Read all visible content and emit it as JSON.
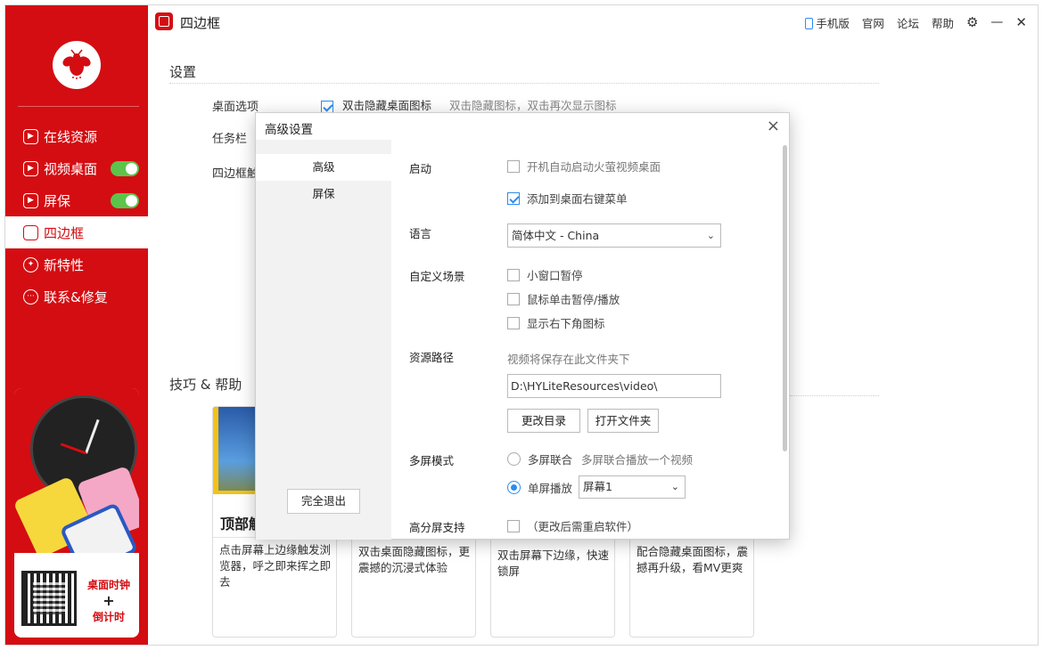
{
  "app": {
    "title": "四边框"
  },
  "top_links": {
    "mobile": "手机版",
    "official": "官网",
    "forum": "论坛",
    "help": "帮助"
  },
  "sidebar": {
    "items": [
      {
        "label": "在线资源",
        "icon": "play-icon",
        "toggle": false
      },
      {
        "label": "视频桌面",
        "icon": "play-icon",
        "toggle": true
      },
      {
        "label": "屏保",
        "icon": "play-icon",
        "toggle": true
      },
      {
        "label": "四边框",
        "icon": "frame-icon",
        "active": true
      },
      {
        "label": "新特性",
        "icon": "bulb-icon"
      },
      {
        "label": "联系&修复",
        "icon": "chat-icon"
      }
    ],
    "promo": {
      "line1": "桌面时钟",
      "plus": "+",
      "line2": "倒计时"
    }
  },
  "settings": {
    "title": "设置",
    "desktop_option_label": "桌面选项",
    "desktop_option_check": "双击隐藏桌面图标",
    "desktop_option_hint": "双击隐藏图标，双击再次显示图标",
    "taskbar_label": "任务栏",
    "frame_label": "四边框触"
  },
  "tips": {
    "title": "技巧 & 帮助",
    "cards": [
      {
        "title": "顶部触",
        "desc": "点击屏幕上边缘触发浏览器，呼之即来挥之即去"
      },
      {
        "desc": "双击桌面隐藏图标，更震撼的沉浸式体验"
      },
      {
        "desc": "双击屏幕下边缘，快速锁屏"
      },
      {
        "desc": "配合隐藏桌面图标，震撼再升级，看MV更爽"
      }
    ]
  },
  "dialog": {
    "title": "高级设置",
    "tabs": [
      "高级",
      "屏保"
    ],
    "exit_button": "完全退出",
    "startup": {
      "label": "启动",
      "autostart": "开机自动启动火萤视频桌面",
      "autostart_checked": false,
      "context_menu": "添加到桌面右键菜单",
      "context_menu_checked": true
    },
    "language": {
      "label": "语言",
      "value": "简体中文 - China"
    },
    "custom_scene": {
      "label": "自定义场景",
      "options": [
        {
          "text": "小窗口暂停",
          "checked": false
        },
        {
          "text": "鼠标单击暂停/播放",
          "checked": false
        },
        {
          "text": "显示右下角图标",
          "checked": false
        }
      ]
    },
    "resource_path": {
      "label": "资源路径",
      "hint": "视频将保存在此文件夹下",
      "value": "D:\\HYLiteResources\\video\\",
      "change_button": "更改目录",
      "open_button": "打开文件夹"
    },
    "multi_screen": {
      "label": "多屏模式",
      "joint": "多屏联合",
      "joint_hint": "多屏联合播放一个视频",
      "single": "单屏播放",
      "screen_value": "屏幕1"
    },
    "hidpi": {
      "label": "高分屏支持",
      "hint": "（更改后需重启软件）"
    }
  },
  "colors": {
    "brand": "#d40d12",
    "accent": "#2d8cf0",
    "toggle_on": "#5cc44b"
  }
}
